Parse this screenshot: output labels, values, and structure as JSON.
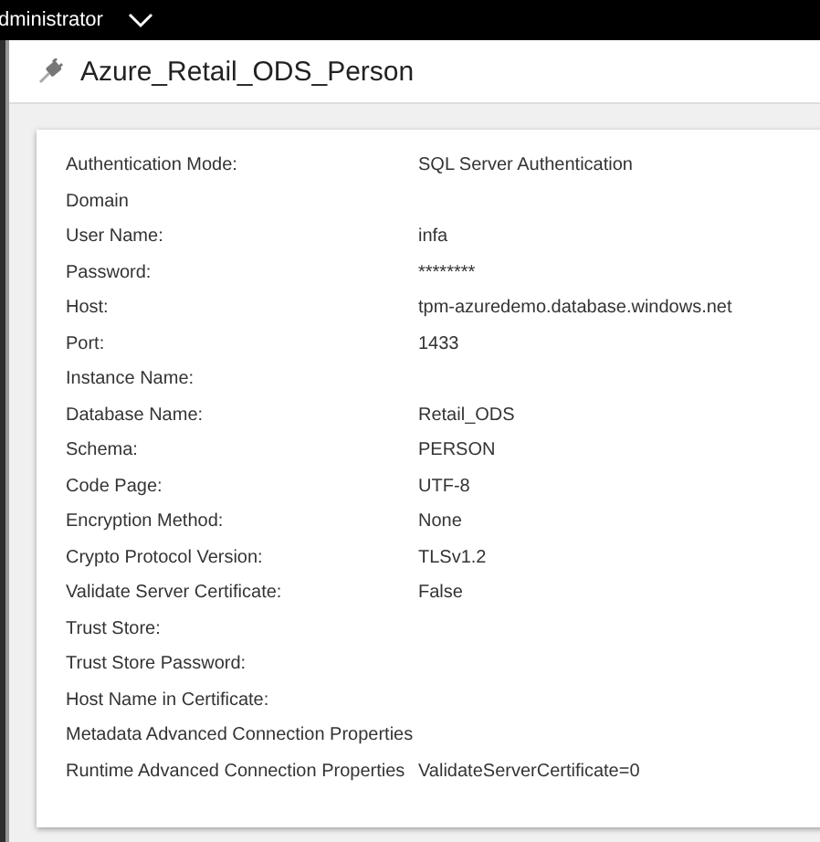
{
  "top_bar": {
    "user": "dministrator"
  },
  "header": {
    "title": "Azure_Retail_ODS_Person"
  },
  "properties": [
    {
      "label": "Authentication Mode:",
      "value": "SQL Server Authentication"
    },
    {
      "label": "Domain"
    },
    {
      "label": "User Name:",
      "value": "infa"
    },
    {
      "label": "Password:",
      "value": "********"
    },
    {
      "label": "Host:",
      "value": "tpm-azuredemo.database.windows.net"
    },
    {
      "label": "Port:",
      "value": "1433"
    },
    {
      "label": "Instance Name:"
    },
    {
      "label": "Database Name:",
      "value": "Retail_ODS"
    },
    {
      "label": "Schema:",
      "value": "PERSON"
    },
    {
      "label": "Code Page:",
      "value": "UTF-8"
    },
    {
      "label": "Encryption Method:",
      "value": "None"
    },
    {
      "label": "Crypto Protocol Version:",
      "value": "TLSv1.2"
    },
    {
      "label": "Validate Server Certificate:",
      "value": "False"
    },
    {
      "label": "Trust Store:"
    },
    {
      "label": "Trust Store Password:"
    },
    {
      "label": "Host Name in Certificate:"
    },
    {
      "label": "Metadata Advanced Connection Properties"
    },
    {
      "label": "Runtime Advanced Connection Properties",
      "value": "ValidateServerCertificate=0"
    }
  ]
}
